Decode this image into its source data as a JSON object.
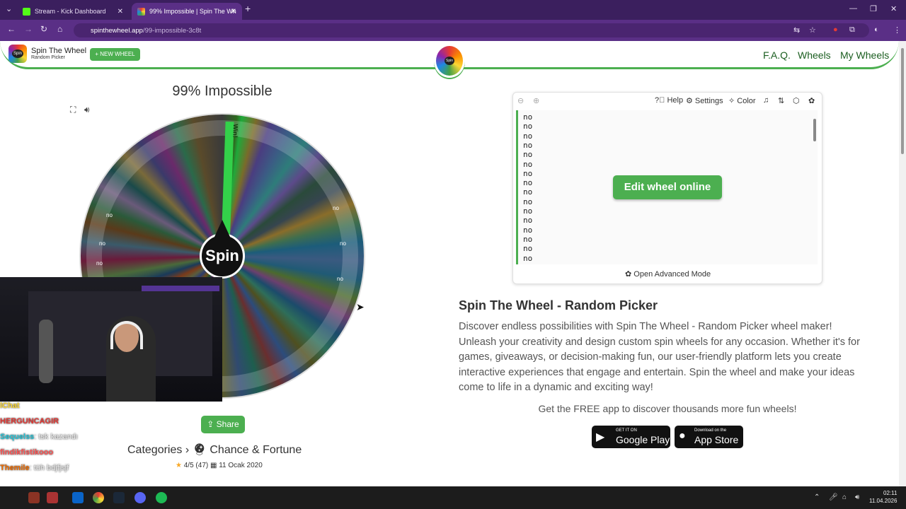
{
  "browser": {
    "tabs": [
      {
        "label": "Stream - Kick Dashboard",
        "icon": "kick-icon"
      },
      {
        "label": "99% Impossible | Spin The Wh",
        "icon": "spin-favicon"
      }
    ],
    "url_host": "spinthewheel.app",
    "url_path": "/99-impossible-3c8t"
  },
  "site": {
    "brand": "Spin The Wheel",
    "brand_sub": "Random Picker",
    "new_wheel": "+ NEW WHEEL",
    "logo_text": "Spin",
    "nav": [
      "F.A.Q.",
      "Wheels",
      "My Wheels"
    ]
  },
  "wheel": {
    "title": "99% Impossible",
    "spin_label": "Spin",
    "win_label": "Win!",
    "entry": "no",
    "share": "Share",
    "categories_label": "Categories",
    "category": "Chance & Fortune",
    "rating": "4/5 (47)",
    "date": "11 Ocak 2020"
  },
  "panel": {
    "toolbar": [
      "Help",
      "Settings",
      "Color"
    ],
    "entries": [
      "no",
      "no",
      "no",
      "no",
      "no",
      "no",
      "no",
      "no",
      "no",
      "no",
      "no",
      "no",
      "no",
      "no",
      "no",
      "no"
    ],
    "edit_button": "Edit wheel online",
    "advanced": "Open Advanced Mode"
  },
  "content": {
    "heading": "Spin The Wheel - Random Picker",
    "description": "Discover endless possibilities with Spin The Wheel - Random Picker wheel maker! Unleash your creativity and design custom spin wheels for any occasion. Whether it's for games, giveaways, or decision-making fun, our user-friendly platform lets you create interactive experiences that engage and entertain. Spin the wheel and make your ideas come to life in a dynamic and exciting way!",
    "get_app": "Get the FREE app to discover thousands more fun wheels!",
    "google_top": "GET IT ON",
    "google_bottom": "Google Play",
    "apple_top": "Download on the",
    "apple_bottom": "App Store"
  },
  "chat": [
    {
      "user": "lChat",
      "msg": ""
    },
    {
      "user": "HERGUNCAGIR",
      "msg": ""
    },
    {
      "user": "Sequelss",
      "msg": ": tsk kazandı"
    },
    {
      "user": "findikfistikooo",
      "msg": ""
    },
    {
      "user": "Themile",
      "msg": ": tüh bdjfjsjf"
    }
  ],
  "taskbar": {
    "time": "02:11",
    "date": "11.04.2026"
  },
  "colors": {
    "accent": "#4caf50",
    "browser": "#5a2f86"
  }
}
